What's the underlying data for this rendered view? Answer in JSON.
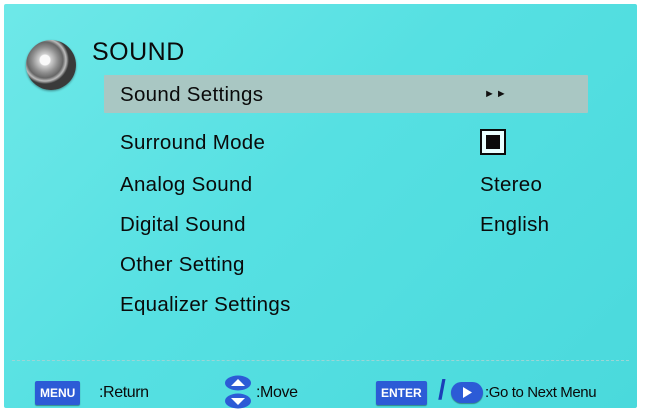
{
  "header": {
    "title": "SOUND",
    "icon": "speaker-icon"
  },
  "menu": {
    "items": [
      {
        "label": "Sound  Settings",
        "value": "",
        "indicator": "►►",
        "selected": true
      },
      {
        "label": "Surround Mode",
        "value": "",
        "indicator": "checkbox-checked",
        "selected": false
      },
      {
        "label": "Analog Sound",
        "value": "Stereo",
        "selected": false
      },
      {
        "label": "Digital Sound",
        "value": "English",
        "selected": false
      },
      {
        "label": "Other Setting",
        "value": "",
        "selected": false
      },
      {
        "label": "Equalizer Settings",
        "value": "",
        "selected": false
      }
    ]
  },
  "footer": {
    "menu_key": "MENU",
    "menu_hint": ":Return",
    "move_hint": ":Move",
    "enter_key": "ENTER",
    "separator": "/",
    "next_hint": ":Go to Next Menu"
  },
  "colors": {
    "background": "#56e0e2",
    "highlight": "#a9c7c3",
    "key_blue": "#2c5bd6"
  }
}
